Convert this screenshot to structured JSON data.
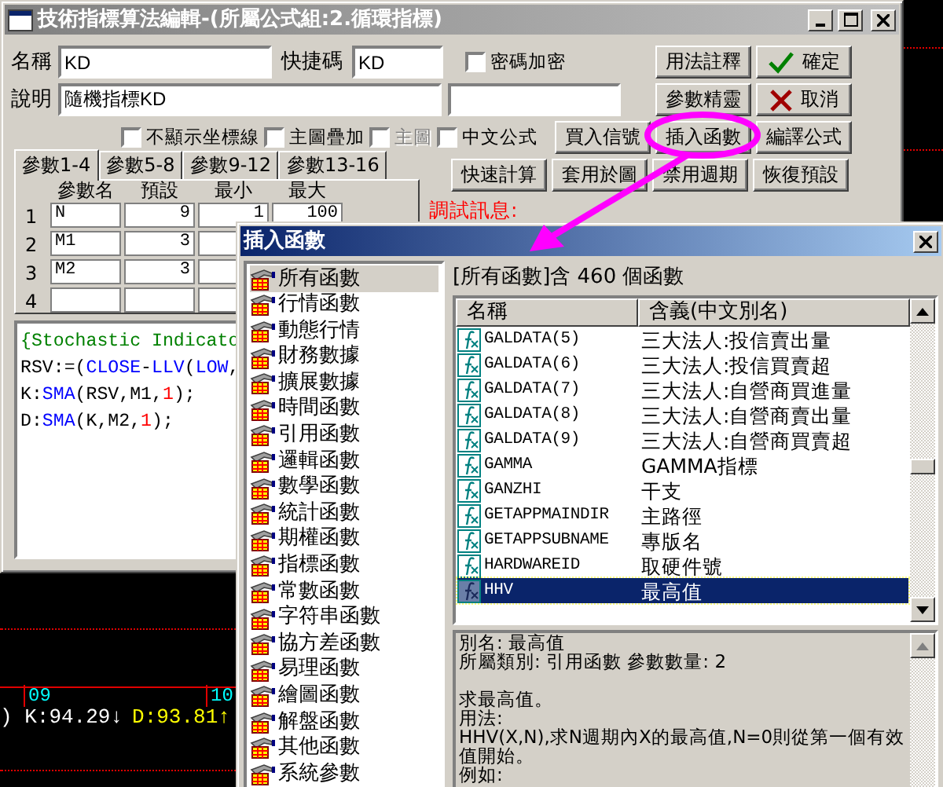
{
  "chart": {
    "time_labels": [
      {
        "text": "09"
      },
      {
        "text": "10"
      }
    ],
    "readout": [
      {
        "kind": "k",
        "text": ") K:94.29↓"
      },
      {
        "kind": "d",
        "text": "D:93.81↑"
      }
    ]
  },
  "editor_window": {
    "title": "技術指標算法編輯-(所屬公式組:2.循環指標)",
    "name_label": "名稱",
    "name_value": "KD",
    "shortcut_label": "快捷碼",
    "shortcut_value": "KD",
    "desc_label": "說明",
    "desc_value": "隨機指標KD",
    "checkboxes": [
      {
        "label": "密碼加密",
        "checked": false,
        "disabled": false
      },
      {
        "label": "不顯示坐標線",
        "checked": false,
        "disabled": false
      },
      {
        "label": "主圖疊加",
        "checked": false,
        "disabled": false
      },
      {
        "label": "主圖",
        "checked": false,
        "disabled": true
      },
      {
        "label": "中文公式",
        "checked": false,
        "disabled": false
      }
    ],
    "buttons": [
      {
        "label": "用法註釋",
        "kind": "plain"
      },
      {
        "label": "確定",
        "kind": "ok"
      },
      {
        "label": "參數精靈",
        "kind": "plain"
      },
      {
        "label": "取消",
        "kind": "cancel"
      },
      {
        "label": "買入信號",
        "kind": "plain"
      },
      {
        "label": "插入函數",
        "kind": "plain"
      },
      {
        "label": "編譯公式",
        "kind": "plain"
      },
      {
        "label": "快速計算",
        "kind": "plain"
      },
      {
        "label": "套用於圖",
        "kind": "plain"
      },
      {
        "label": "禁用週期",
        "kind": "plain"
      },
      {
        "label": "恢復預設",
        "kind": "plain"
      }
    ],
    "tabs": [
      {
        "label": "參數1-4",
        "selected": true
      },
      {
        "label": "參數5-8",
        "selected": false
      },
      {
        "label": "參數9-12",
        "selected": false
      },
      {
        "label": "參數13-16",
        "selected": false
      }
    ],
    "param_table": {
      "columns": [
        "參數名",
        "預設",
        "最小",
        "最大"
      ],
      "rows": [
        {
          "index": "1",
          "cells": [
            "N",
            "9",
            "1",
            "100"
          ]
        },
        {
          "index": "2",
          "cells": [
            "M1",
            "3"
          ]
        },
        {
          "index": "3",
          "cells": [
            "M2",
            "3"
          ]
        },
        {
          "index": "4"
        }
      ]
    },
    "debug_label": "調試訊息:",
    "code": [
      [
        {
          "kind": "comment",
          "text": "{Stochastic Indicato"
        }
      ],
      [
        {
          "kind": "plain",
          "text": "RSV:=("
        },
        {
          "kind": "func",
          "text": "CLOSE"
        },
        {
          "kind": "plain",
          "text": "-"
        },
        {
          "kind": "func",
          "text": "LLV"
        },
        {
          "kind": "plain",
          "text": "("
        },
        {
          "kind": "func",
          "text": "LOW"
        },
        {
          "kind": "plain",
          "text": ","
        }
      ],
      [
        {
          "kind": "plain",
          "text": "K:"
        },
        {
          "kind": "func",
          "text": "SMA"
        },
        {
          "kind": "plain",
          "text": "(RSV,M1,"
        },
        {
          "kind": "num",
          "text": "1"
        },
        {
          "kind": "plain",
          "text": ");"
        }
      ],
      [
        {
          "kind": "plain",
          "text": "D:"
        },
        {
          "kind": "func",
          "text": "SMA"
        },
        {
          "kind": "plain",
          "text": "(K,M2,"
        },
        {
          "kind": "num",
          "text": "1"
        },
        {
          "kind": "plain",
          "text": ");"
        }
      ]
    ]
  },
  "insert_dialog": {
    "title": "插入函數",
    "categories": [
      {
        "label": "所有函數",
        "selected": true
      },
      {
        "label": "行情函數",
        "selected": false
      },
      {
        "label": "動態行情",
        "selected": false
      },
      {
        "label": "財務數據",
        "selected": false
      },
      {
        "label": "擴展數據",
        "selected": false
      },
      {
        "label": "時間函數",
        "selected": false
      },
      {
        "label": "引用函數",
        "selected": false
      },
      {
        "label": "邏輯函數",
        "selected": false
      },
      {
        "label": "數學函數",
        "selected": false
      },
      {
        "label": "統計函數",
        "selected": false
      },
      {
        "label": "期權函數",
        "selected": false
      },
      {
        "label": "指標函數",
        "selected": false
      },
      {
        "label": "常數函數",
        "selected": false
      },
      {
        "label": "字符串函數",
        "selected": false
      },
      {
        "label": "協方差函數",
        "selected": false
      },
      {
        "label": "易理函數",
        "selected": false
      },
      {
        "label": "繪圖函數",
        "selected": false
      },
      {
        "label": "解盤函數",
        "selected": false
      },
      {
        "label": "其他函數",
        "selected": false
      },
      {
        "label": "系統參數",
        "selected": false
      }
    ],
    "summary": "[所有函數]含 460 個函數",
    "columns": [
      "名稱",
      "含義(中文別名)"
    ],
    "functions": [
      {
        "name": "GALDATA(5)",
        "alias": "三大法人:投信賣出量",
        "selected": false
      },
      {
        "name": "GALDATA(6)",
        "alias": "三大法人:投信買賣超",
        "selected": false
      },
      {
        "name": "GALDATA(7)",
        "alias": "三大法人:自營商買進量",
        "selected": false
      },
      {
        "name": "GALDATA(8)",
        "alias": "三大法人:自營商賣出量",
        "selected": false
      },
      {
        "name": "GALDATA(9)",
        "alias": "三大法人:自營商買賣超",
        "selected": false
      },
      {
        "name": "GAMMA",
        "alias": "GAMMA指標",
        "selected": false
      },
      {
        "name": "GANZHI",
        "alias": "干支",
        "selected": false
      },
      {
        "name": "GETAPPMAINDIR",
        "alias": "主路徑",
        "selected": false
      },
      {
        "name": "GETAPPSUBNAME",
        "alias": "專版名",
        "selected": false
      },
      {
        "name": "HARDWAREID",
        "alias": "取硬件號",
        "selected": false
      },
      {
        "name": "HHV",
        "alias": "最高值",
        "selected": true
      }
    ],
    "description": [
      [
        "別名: 最高值",
        "所屬類別: 引用函數   參數數量: 2"
      ],
      [
        "求最高值。",
        "用法:",
        "HHV(X,N),求N週期內X的最高值,N=0則從第一個有效值開始。",
        "例如:"
      ]
    ]
  }
}
